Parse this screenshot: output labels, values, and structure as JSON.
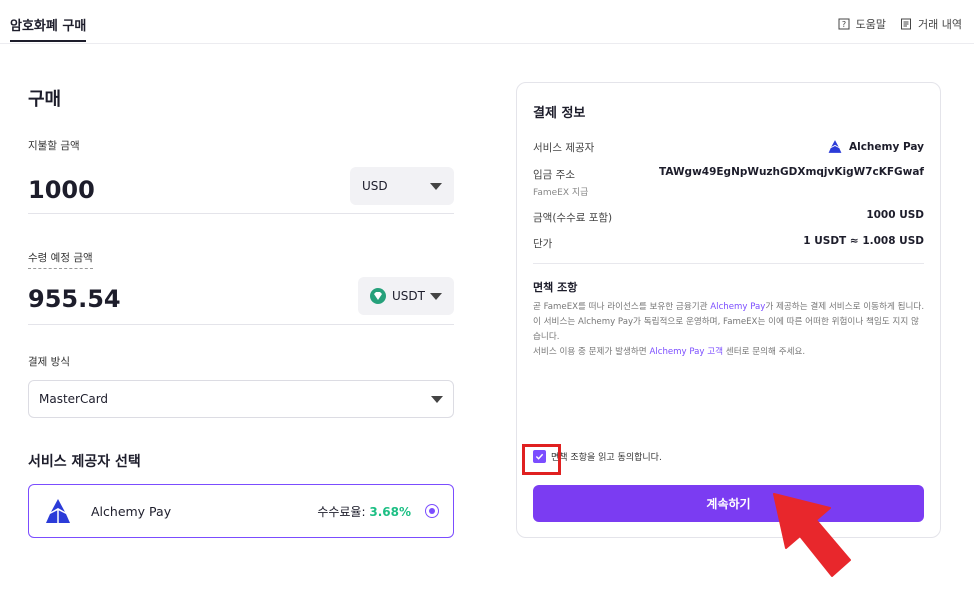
{
  "header": {
    "tab_label": "암호화폐 구매",
    "help_label": "도움말",
    "history_label": "거래 내역"
  },
  "buy": {
    "title": "구매",
    "pay_label": "지불할 금액",
    "pay_amount": "1000",
    "pay_currency": "USD",
    "receive_label": "수령 예정 금액",
    "receive_amount": "955.54",
    "receive_currency": "USDT",
    "method_label": "결제 방식",
    "method_value": "MasterCard",
    "provider_title": "서비스 제공자 선택",
    "provider_name": "Alchemy Pay",
    "fee_label": "수수료율:",
    "fee_value": "3.68%"
  },
  "payment_info": {
    "title": "결제 정보",
    "provider_label": "서비스 제공자",
    "provider_value": "Alchemy Pay",
    "address_label": "입금 주소",
    "address_sub": "FameEX 지급",
    "address_value": "TAWgw49EgNpWuzhGDXmqjvKigW7cKFGwaf",
    "amount_label": "금액(수수료 포함)",
    "amount_value": "1000 USD",
    "price_label": "단가",
    "price_value": "1 USDT ≈ 1.008 USD",
    "disclaimer_title": "면책 조항",
    "disclaimer_1a": "곧 FameEX를 떠나 라이선스를 보유한 금융기관 ",
    "disclaimer_1b": "Alchemy Pay",
    "disclaimer_1c": "가 제공하는 결제 서비스로 이동하게 됩니다. 이 서비스는 Alchemy Pay가 독립적으로 운영하며, FameEX는 이에 따른 어떠한 위험이나 책임도 지지 않습니다.",
    "disclaimer_2a": "서비스 이용 중 문제가 발생하면 ",
    "disclaimer_2b": "Alchemy Pay 고객",
    "disclaimer_2c": " 센터로 문의해 주세요.",
    "agree_label": "면책 조항을 읽고 동의합니다.",
    "continue_label": "계속하기"
  },
  "colors": {
    "accent": "#7b3cf2",
    "fee_green": "#1dbf84",
    "highlight_red": "#e02020"
  }
}
